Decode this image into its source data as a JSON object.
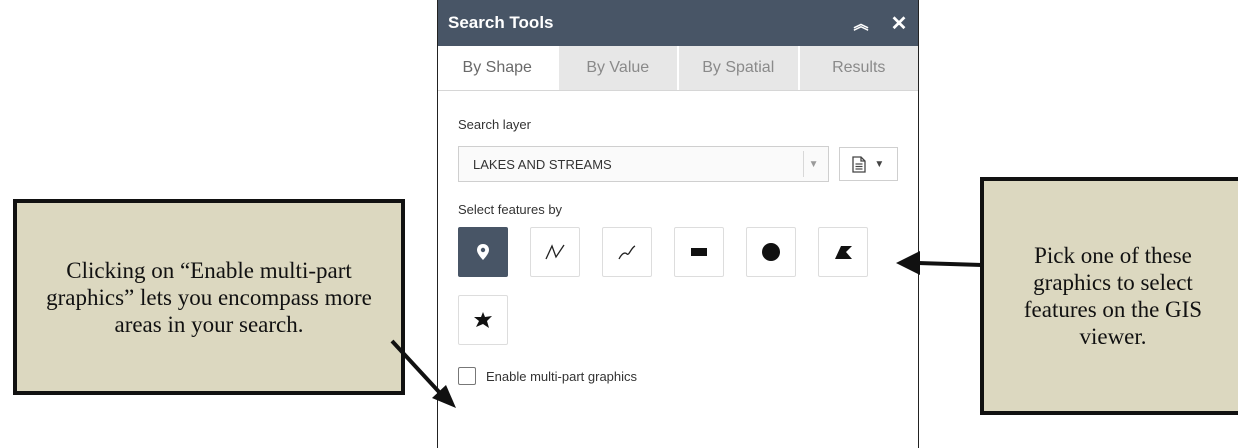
{
  "widget": {
    "title": "Search Tools",
    "tabs": [
      {
        "label": "By Shape",
        "active": true
      },
      {
        "label": "By Value",
        "active": false
      },
      {
        "label": "By Spatial",
        "active": false
      },
      {
        "label": "Results",
        "active": false
      }
    ],
    "search_layer_label": "Search layer",
    "search_layer_value": "LAKES AND STREAMS",
    "select_features_label": "Select features by",
    "tools": [
      {
        "icon": "point-icon",
        "active": true
      },
      {
        "icon": "polyline-icon",
        "active": false
      },
      {
        "icon": "freehand-polyline-icon",
        "active": false
      },
      {
        "icon": "rectangle-icon",
        "active": false
      },
      {
        "icon": "circle-icon",
        "active": false
      },
      {
        "icon": "polygon-icon",
        "active": false
      },
      {
        "icon": "freehand-polygon-icon",
        "active": false
      }
    ],
    "multipart_checkbox_label": "Enable multi-part graphics",
    "multipart_checked": false
  },
  "callouts": {
    "left": "Clicking on “Enable multi-part graphics” lets you encompass more areas in your search.",
    "right": "Pick one of these graphics to select features on the GIS viewer."
  },
  "colors": {
    "titlebar": "#485566",
    "callout_bg": "#dcd8c0",
    "active_tool": "#485566"
  }
}
